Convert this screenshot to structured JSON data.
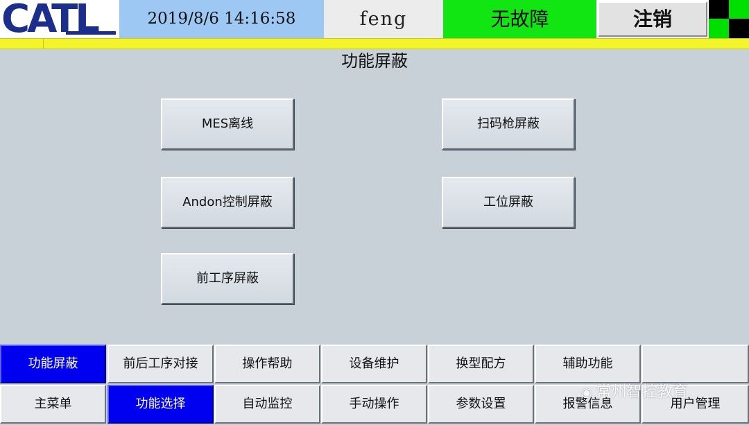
{
  "header": {
    "logo_text": "CATL",
    "datetime": "2019/8/6  14:16:58",
    "user": "feng",
    "status": "无故障",
    "status_color": "#12e612",
    "logout_label": "注销"
  },
  "page_title": "功能屏蔽",
  "function_buttons": [
    {
      "label": "MES离线"
    },
    {
      "label": "扫码枪屏蔽"
    },
    {
      "label": "Andon控制屏蔽"
    },
    {
      "label": "工位屏蔽"
    },
    {
      "label": "前工序屏蔽"
    }
  ],
  "nav_row1": [
    {
      "label": "功能屏蔽",
      "active": true
    },
    {
      "label": "前后工序对接"
    },
    {
      "label": "操作帮助"
    },
    {
      "label": "设备维护"
    },
    {
      "label": "换型配方"
    },
    {
      "label": "辅助功能"
    },
    {
      "label": ""
    }
  ],
  "nav_row2": [
    {
      "label": "主菜单"
    },
    {
      "label": "功能选择",
      "active": true
    },
    {
      "label": "自动监控"
    },
    {
      "label": "手动操作"
    },
    {
      "label": "参数设置"
    },
    {
      "label": "报警信息"
    },
    {
      "label": "用户管理"
    }
  ],
  "colors": {
    "active_nav": "#0000f0",
    "background": "#c8d0d8",
    "header_yellow": "#f4f42a"
  },
  "watermark": {
    "icon": "wechat-icon",
    "text": "常州智控教育"
  }
}
